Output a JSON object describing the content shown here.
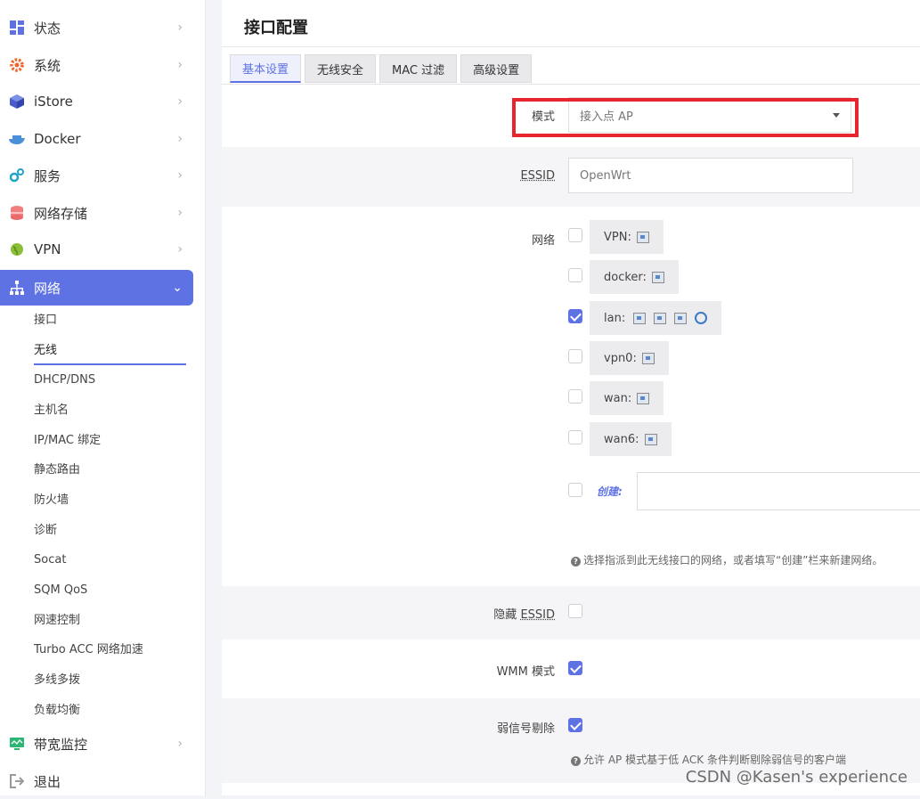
{
  "sidebar": {
    "top_items": [
      {
        "label": "状态",
        "icon": "dashboard-icon"
      },
      {
        "label": "系统",
        "icon": "gear-icon"
      },
      {
        "label": "iStore",
        "icon": "cube-icon"
      },
      {
        "label": "Docker",
        "icon": "docker-icon"
      },
      {
        "label": "服务",
        "icon": "services-icon"
      },
      {
        "label": "网络存储",
        "icon": "database-icon"
      },
      {
        "label": "VPN",
        "icon": "globe-icon"
      },
      {
        "label": "网络",
        "icon": "network-icon"
      }
    ],
    "sub_items": [
      "接口",
      "无线",
      "DHCP/DNS",
      "主机名",
      "IP/MAC 绑定",
      "静态路由",
      "防火墙",
      "诊断",
      "Socat",
      "SQM QoS",
      "网速控制",
      "Turbo ACC 网络加速",
      "多线多拨",
      "负载均衡"
    ],
    "bottom_items": [
      {
        "label": "带宽监控",
        "icon": "monitor-icon"
      },
      {
        "label": "退出",
        "icon": "logout-icon"
      }
    ]
  },
  "main": {
    "title": "接口配置",
    "tabs": [
      "基本设置",
      "无线安全",
      "MAC 过滤",
      "高级设置"
    ],
    "mode": {
      "label": "模式",
      "value": "接入点 AP"
    },
    "essid": {
      "label": "ESSID",
      "placeholder": "OpenWrt"
    },
    "network": {
      "label": "网络",
      "options": [
        {
          "name": "VPN:",
          "checked": false
        },
        {
          "name": "docker:",
          "checked": false
        },
        {
          "name": "lan:",
          "checked": true
        },
        {
          "name": "vpn0:",
          "checked": false
        },
        {
          "name": "wan:",
          "checked": false
        },
        {
          "name": "wan6:",
          "checked": false
        }
      ],
      "create_label": "创建:",
      "help": "选择指派到此无线接口的网络，或者填写“创建”栏来新建网络。"
    },
    "hide_essid": {
      "label_prefix": "隐藏 ",
      "label_essid": "ESSID",
      "checked": false
    },
    "wmm": {
      "label": "WMM 模式",
      "checked": true
    },
    "weak_signal": {
      "label": "弱信号剔除",
      "checked": true,
      "help": "允许 AP 模式基于低 ACK 条件判断剔除弱信号的客户端"
    }
  },
  "watermark": "CSDN @Kasen's experience",
  "colors": {
    "accent": "#5e72e4",
    "highlight_box": "#e8242e"
  }
}
